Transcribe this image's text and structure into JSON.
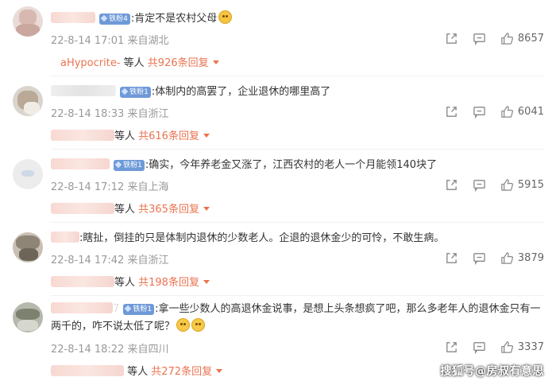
{
  "comments": [
    {
      "badge": "铁粉4",
      "text": ":肯定不是农村父母",
      "emoji": "smiling-emoji",
      "time": "22-8-14 17:01",
      "location": "来自湖北",
      "likes": "8657",
      "reply_user": "aHypocrite-",
      "reply_mid": " 等人 ",
      "reply_total": "共926条回复"
    },
    {
      "badge": "铁粉1",
      "text": ":体制内的高罢了，企业退休的哪里高了",
      "time": "22-8-14 18:33",
      "location": "来自浙江",
      "likes": "6041",
      "reply_mid": "等人 ",
      "reply_total": "共616条回复"
    },
    {
      "badge": "铁粉1",
      "text": ":确实，今年养老金又涨了，江西农村的老人一个月能领140块了",
      "time": "22-8-14 17:12",
      "location": "来自上海",
      "likes": "5915",
      "reply_mid": "等人 ",
      "reply_total": "共365条回复"
    },
    {
      "text": ":瞎扯，倒挂的只是体制内退休的少数老人。企退的退休金少的可怜，不敢生病。",
      "time": "22-8-14 17:42",
      "location": "来自浙江",
      "likes": "3879",
      "reply_mid": "等人 ",
      "reply_total": "共198条回复"
    },
    {
      "name_tail": "7",
      "badge": "铁粉1",
      "text": ":拿一些少数人的高退休金说事，是想上头条想疯了吧，那么多老年人的退休金只有一两千的，咋不说太低了呢？",
      "emoji": "grimace-emoji",
      "time": "22-8-14 18:22",
      "location": "来自四川",
      "likes": "3337",
      "reply_mid": " 等人 ",
      "reply_total": "共272条回复"
    }
  ],
  "watermark": "搜狐号@房叔有意思"
}
